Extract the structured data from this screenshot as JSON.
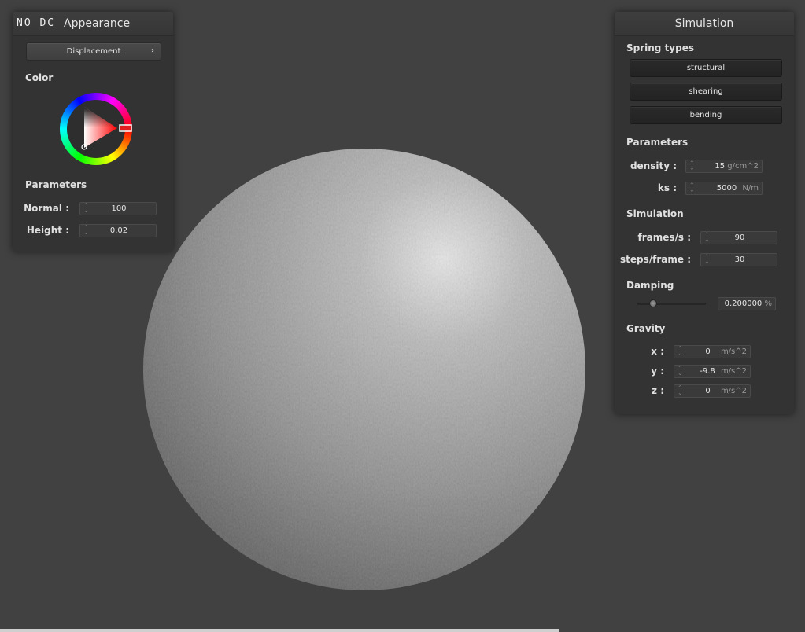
{
  "appearance": {
    "brand": "NO DC",
    "title": "Appearance",
    "displacement_label": "Displacement",
    "color_label": "Color",
    "parameters_label": "Parameters",
    "normal_label": "Normal :",
    "normal_value": "100",
    "height_label": "Height :",
    "height_value": "0.02"
  },
  "simulation": {
    "title": "Simulation",
    "spring_types_label": "Spring types",
    "structural_label": "structural",
    "shearing_label": "shearing",
    "bending_label": "bending",
    "parameters_label": "Parameters",
    "density_label": "density :",
    "density_value": "15",
    "density_unit": "g/cm^2",
    "ks_label": "ks :",
    "ks_value": "5000",
    "ks_unit": "N/m",
    "simulation_label": "Simulation",
    "fps_label": "frames/s :",
    "fps_value": "90",
    "steps_label": "steps/frame :",
    "steps_value": "30",
    "damping_label": "Damping",
    "damping_value": "0.200000",
    "damping_unit": "%",
    "damping_slider_fraction": 0.2,
    "gravity_label": "Gravity",
    "gx_label": "x :",
    "gx_value": "0",
    "gy_label": "y :",
    "gy_value": "-9.8",
    "gz_label": "z :",
    "gz_value": "0",
    "gravity_unit": "m/s^2"
  },
  "colors": {
    "background": "#414141",
    "panel": "#333333",
    "accent_red": "#e02020"
  }
}
